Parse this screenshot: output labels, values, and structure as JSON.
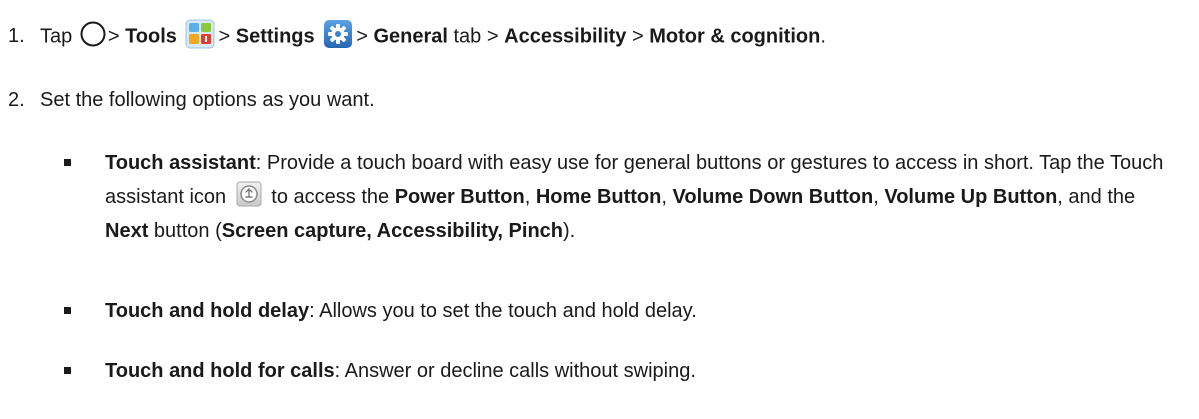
{
  "steps": [
    {
      "number": "1.",
      "tap": "Tap",
      "sep1": ">",
      "tools": "Tools",
      "sep2": ">",
      "settings": "Settings",
      "sep3": ">",
      "general": "General",
      "tab_word": "tab",
      "sep4": ">",
      "accessibility": "Accessibility",
      "sep5": ">",
      "motor": "Motor & cognition",
      "end": "."
    },
    {
      "number": "2.",
      "text": "Set the following options as you want."
    }
  ],
  "options": [
    {
      "title": "Touch assistant",
      "text_a": ": Provide a touch board with easy use for general buttons or gestures to access in short. Tap the Touch assistant icon",
      "text_b": "to access the",
      "power": "Power Button",
      "c1": ",",
      "home": "Home Button",
      "c2": ",",
      "vol_down": "Volume Down Button",
      "c3": ",",
      "vol_up": "Volume Up Button",
      "and_the": ", and the",
      "next": "Next",
      "button_word": "button (",
      "next_items": "Screen capture, Accessibility, Pinch",
      "close": ")."
    },
    {
      "title": "Touch and hold delay",
      "text": ": Allows you to set the touch and hold delay."
    },
    {
      "title": "Touch and hold for calls",
      "text": ": Answer or decline calls without swiping."
    }
  ],
  "icons": {
    "home": "home-circle-icon",
    "tools": "tools-folder-icon",
    "settings": "settings-gear-icon",
    "touch_assistant": "touch-assistant-icon"
  },
  "colors": {
    "text": "#1a1a1a",
    "settings_blue": "#2f7fd0",
    "tools_red": "#e33d2e",
    "tools_orange": "#f5a623",
    "tools_blue": "#3b9be0"
  }
}
